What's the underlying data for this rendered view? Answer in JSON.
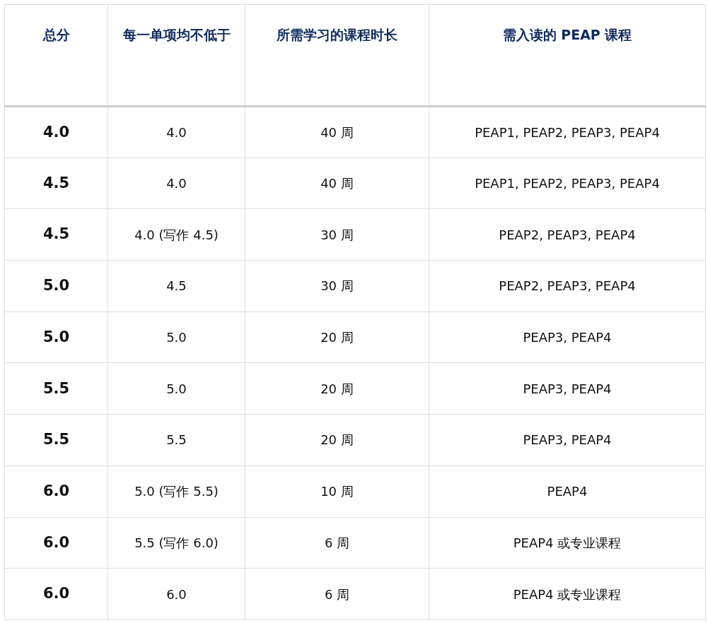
{
  "table": {
    "columns": [
      "总分",
      "每一单项均不低于",
      "所需学习的课程时长",
      "需入读的 PEAP 课程"
    ],
    "rows": [
      [
        "4.0",
        "4.0",
        "40 周",
        "PEAP1, PEAP2, PEAP3, PEAP4"
      ],
      [
        "4.5",
        "4.0",
        "40 周",
        "PEAP1, PEAP2, PEAP3, PEAP4"
      ],
      [
        "4.5",
        "4.0 (写作 4.5)",
        "30 周",
        "PEAP2, PEAP3, PEAP4"
      ],
      [
        "5.0",
        "4.5",
        "30 周",
        "PEAP2, PEAP3, PEAP4"
      ],
      [
        "5.0",
        "5.0",
        "20 周",
        "PEAP3, PEAP4"
      ],
      [
        "5.5",
        "5.0",
        "20 周",
        "PEAP3, PEAP4"
      ],
      [
        "5.5",
        "5.5",
        "20 周",
        "PEAP3, PEAP4"
      ],
      [
        "6.0",
        "5.0 (写作 5.5)",
        "10 周",
        "PEAP4"
      ],
      [
        "6.0",
        "5.5 (写作 6.0)",
        "6 周",
        "PEAP4 或专业课程"
      ],
      [
        "6.0",
        "6.0",
        "6 周",
        "PEAP4 或专业课程"
      ]
    ]
  }
}
